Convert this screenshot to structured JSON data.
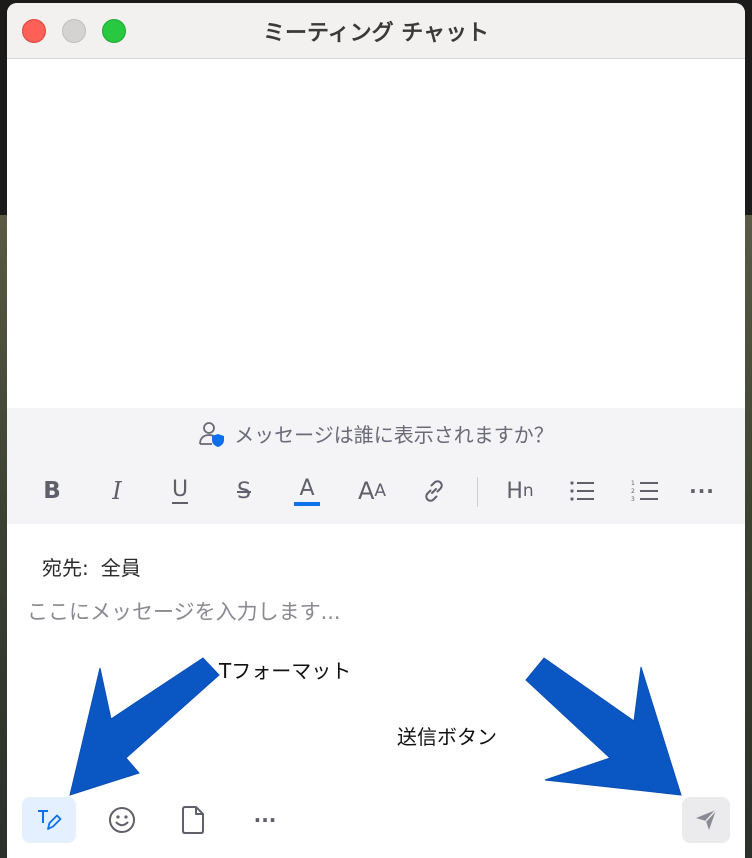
{
  "window": {
    "title": "ミーティング チャット"
  },
  "visibility_bar": {
    "text": "メッセージは誰に表示されますか？",
    "icon": "person-shield-icon"
  },
  "format_toolbar": {
    "bold": "B",
    "italic": "I",
    "underline": "U",
    "strikethrough": "S",
    "font_color": "A",
    "font_size_big": "A",
    "font_size_small": "A",
    "link_icon": "link-icon",
    "heading_main": "H",
    "heading_sub": "n",
    "bullet_list_icon": "bullet-list-icon",
    "numbered_list_icon": "numbered-list-icon",
    "more": "···",
    "accent_color": "#0e71eb"
  },
  "compose": {
    "to_label": "宛先:",
    "to_value": "全員",
    "placeholder": "ここにメッセージを入力します..."
  },
  "annotations": {
    "format_label": "Tフォーマット",
    "send_label": "送信ボタン",
    "arrow_color": "#0a57c4"
  },
  "bottom_toolbar": {
    "format_icon": "text-format-icon",
    "emoji_icon": "emoji-icon",
    "file_icon": "file-icon",
    "more": "···",
    "send_icon": "send-icon"
  }
}
